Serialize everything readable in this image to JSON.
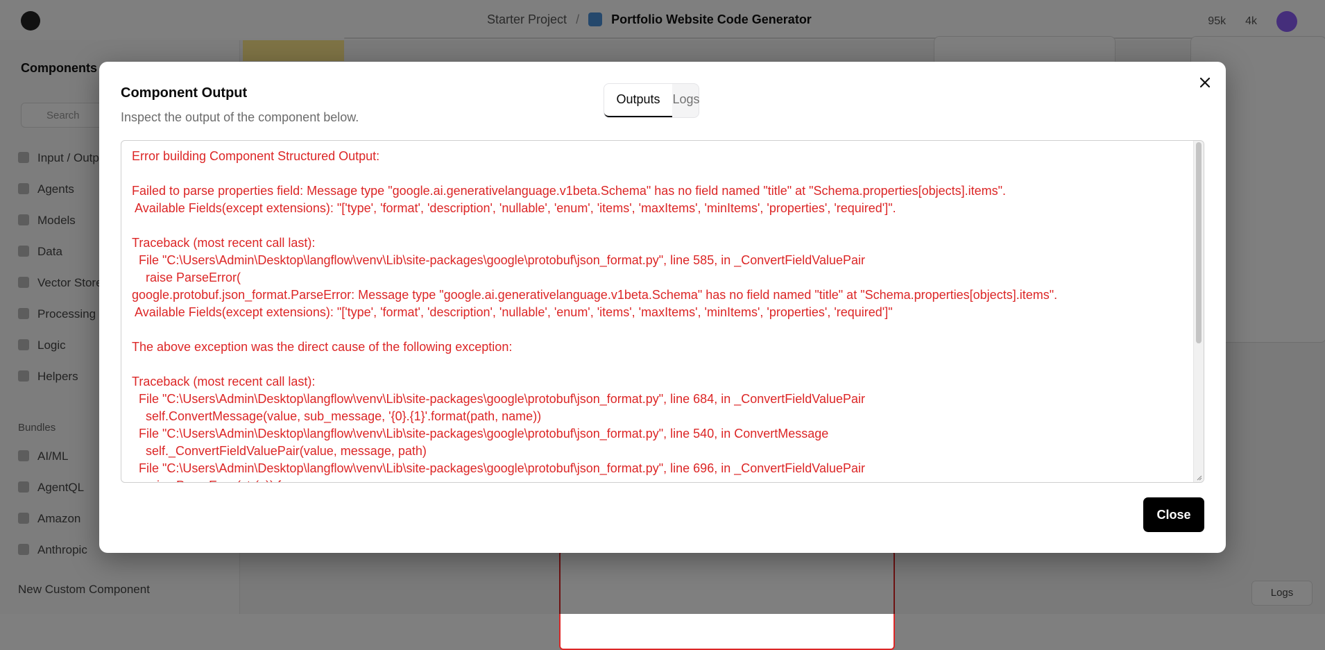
{
  "background": {
    "breadcrumb": {
      "project": "Starter Project",
      "flow": "Portfolio Website Code Generator"
    },
    "top_right": {
      "stars": "95k",
      "members": "4k"
    },
    "sidebar": {
      "title": "Components",
      "search_placeholder": "Search",
      "items": [
        "Input / Output",
        "Agents",
        "Models",
        "Data",
        "Vector Stores",
        "Processing",
        "Logic",
        "Helpers"
      ],
      "bundles_heading": "Bundles",
      "bundles": [
        "AI/ML",
        "AgentQL",
        "Amazon",
        "Anthropic"
      ],
      "new_component": "New Custom Component"
    },
    "canvas": {
      "logs_button": "Logs"
    }
  },
  "modal": {
    "title": "Component Output",
    "subtitle": "Inspect the output of the component below.",
    "tabs": [
      {
        "label": "Outputs",
        "active": true
      },
      {
        "label": "Logs",
        "active": false
      }
    ],
    "close_icon": "close-icon",
    "output_text": "Error building Component Structured Output:\n\nFailed to parse properties field: Message type \"google.ai.generativelanguage.v1beta.Schema\" has no field named \"title\" at \"Schema.properties[objects].items\".\n Available Fields(except extensions): \"['type', 'format', 'description', 'nullable', 'enum', 'items', 'maxItems', 'minItems', 'properties', 'required']\".\n\nTraceback (most recent call last):\n  File \"C:\\Users\\Admin\\Desktop\\langflow\\venv\\Lib\\site-packages\\google\\protobuf\\json_format.py\", line 585, in _ConvertFieldValuePair\n    raise ParseError(\ngoogle.protobuf.json_format.ParseError: Message type \"google.ai.generativelanguage.v1beta.Schema\" has no field named \"title\" at \"Schema.properties[objects].items\".\n Available Fields(except extensions): \"['type', 'format', 'description', 'nullable', 'enum', 'items', 'maxItems', 'minItems', 'properties', 'required']\"\n\nThe above exception was the direct cause of the following exception:\n\nTraceback (most recent call last):\n  File \"C:\\Users\\Admin\\Desktop\\langflow\\venv\\Lib\\site-packages\\google\\protobuf\\json_format.py\", line 684, in _ConvertFieldValuePair\n    self.ConvertMessage(value, sub_message, '{0}.{1}'.format(path, name))\n  File \"C:\\Users\\Admin\\Desktop\\langflow\\venv\\Lib\\site-packages\\google\\protobuf\\json_format.py\", line 540, in ConvertMessage\n    self._ConvertFieldValuePair(value, message, path)\n  File \"C:\\Users\\Admin\\Desktop\\langflow\\venv\\Lib\\site-packages\\google\\protobuf\\json_format.py\", line 696, in _ConvertFieldValuePair\n    raise ParseError(str(e)) from e",
    "close_button": "Close"
  },
  "colors": {
    "error_text": "#dc2626",
    "primary_button": "#000000",
    "overlay": "rgba(0,0,0,0.5)"
  }
}
